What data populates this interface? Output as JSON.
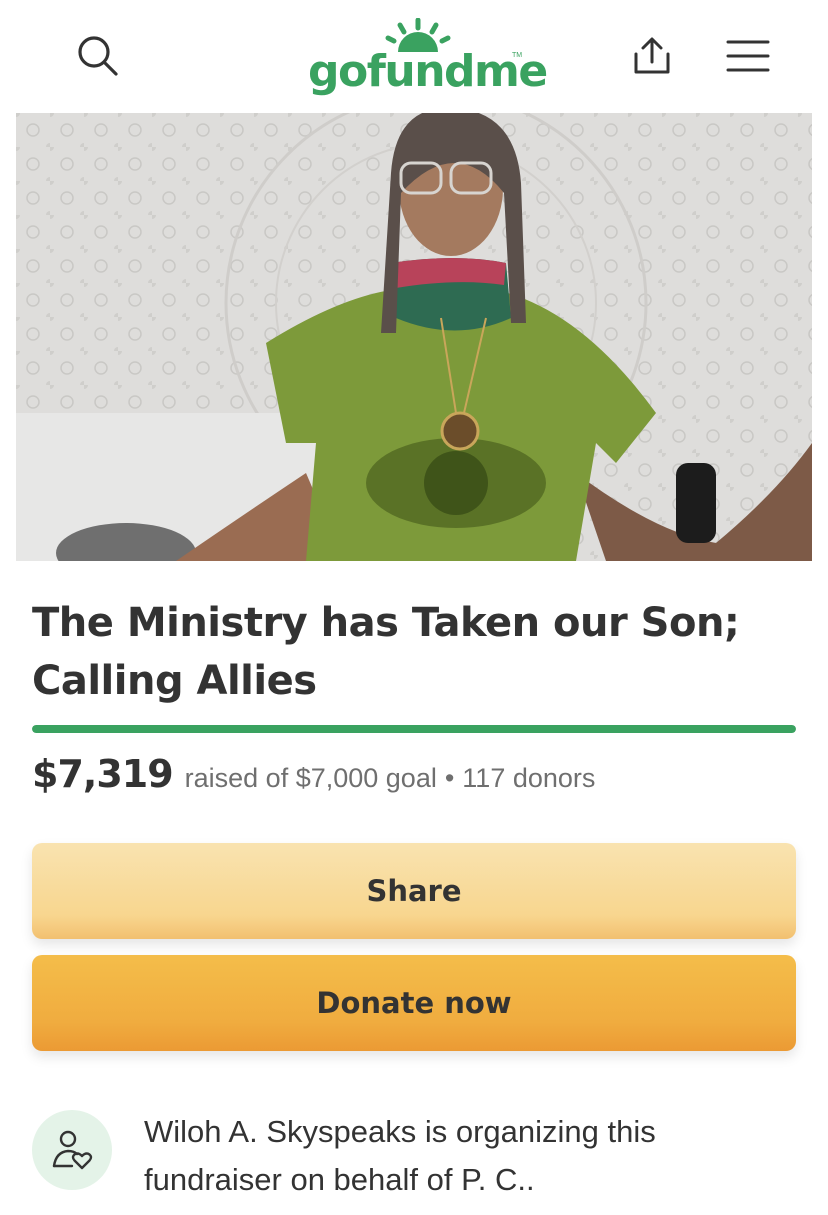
{
  "header": {
    "logo_text": "gofundme",
    "logo_tm": "TM",
    "search_icon": "search-icon",
    "share_icon": "share-upload-icon",
    "menu_icon": "hamburger-menu-icon"
  },
  "hero": {
    "image_icon": "campaign-photo"
  },
  "campaign": {
    "title": "The Ministry has Taken our Son; Calling Allies",
    "progress": 1.0,
    "raised": "$7,319",
    "goal_text": "raised of $7,000 goal",
    "separator": "•",
    "donors_text": "117 donors"
  },
  "actions": {
    "share_label": "Share",
    "donate_label": "Donate now"
  },
  "organizer": {
    "icon": "person-heart-icon",
    "text": "Wiloh A. Skyspeaks is organizing this fundraiser on behalf of P. C.."
  },
  "colors": {
    "brand_green": "#3aa260",
    "share_button": "#f8d68f",
    "donate_button": "#f0ac3f",
    "text": "#333333",
    "muted_text": "#6f6f6f"
  }
}
